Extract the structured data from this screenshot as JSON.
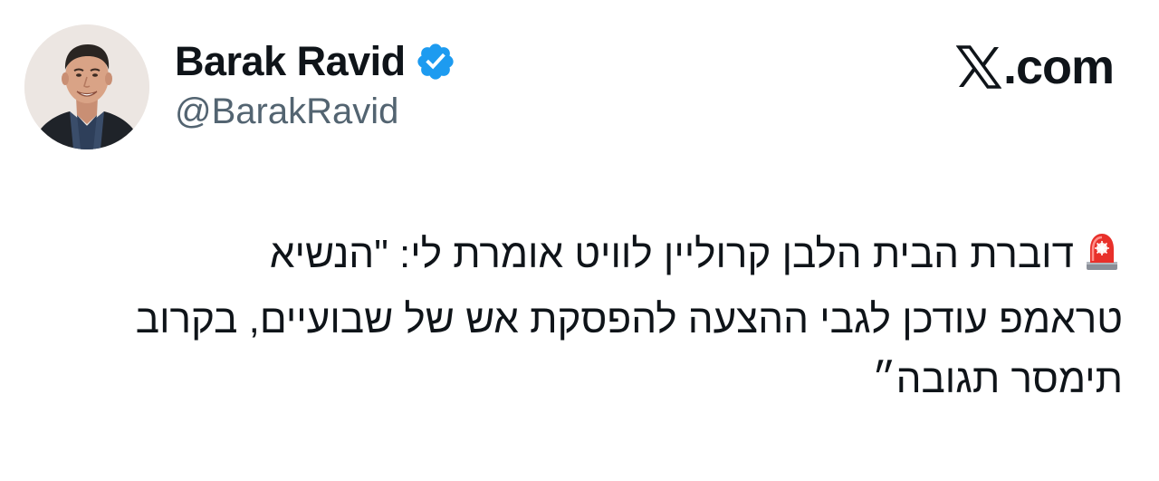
{
  "author": {
    "display_name": "Barak Ravid",
    "handle": "@BarakRavid",
    "verified": true,
    "avatar_icon": "profile-photo",
    "verified_icon": "verified-badge-icon"
  },
  "brand": {
    "logo_icon": "x-logo-icon",
    "suffix": ".com"
  },
  "tweet": {
    "emoji_icon": "police-car-light-icon",
    "lines": [
      "דוברת הבית הלבן קרוליין לוויט אומרת לי: \"הנשיא",
      "טראמפ עודכן לגבי ההצעה להפסקת אש של שבועיים, בקרוב",
      "תימסר תגובה״"
    ]
  },
  "colors": {
    "text_primary": "#0f1419",
    "text_secondary": "#536471",
    "verified_blue": "#1d9bf0",
    "siren_red": "#e8302a"
  }
}
